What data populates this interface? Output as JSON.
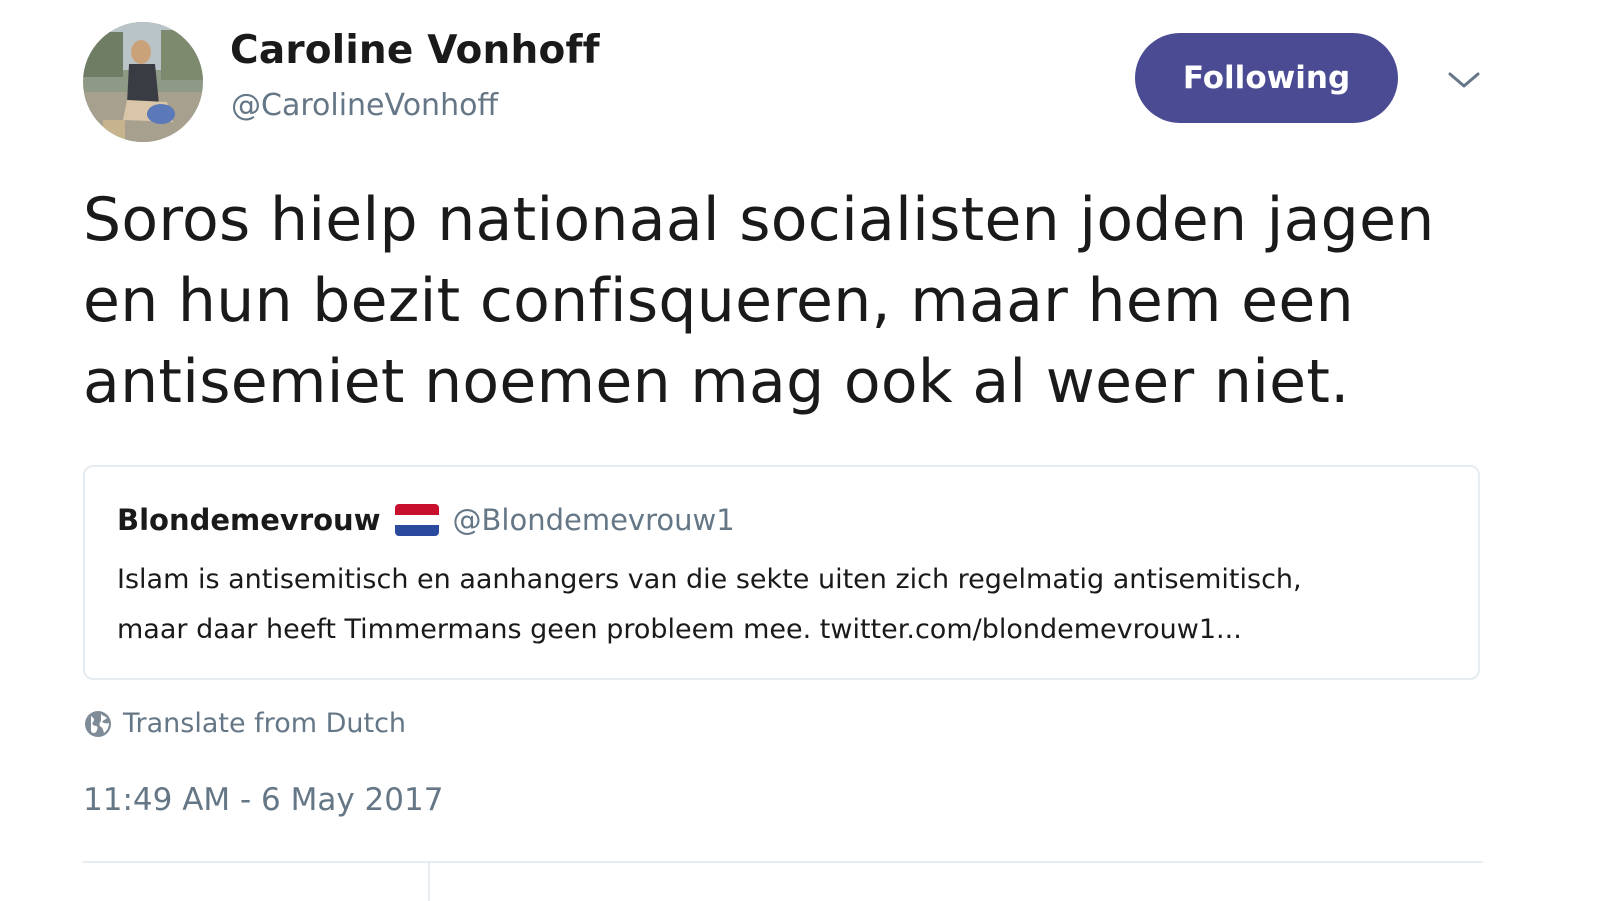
{
  "author": {
    "display_name": "Caroline Vonhoff",
    "screen_name": "@CarolineVonhoff",
    "avatar_icon": "user-photo-avatar"
  },
  "follow_button": {
    "label": "Following",
    "color": "#4b4b94"
  },
  "menu": {
    "icon": "chevron-down-icon"
  },
  "tweet": {
    "text_lines": [
      "Soros hielp nationaal socialisten joden jagen",
      "en hun bezit confisqueren, maar hem een",
      "antisemiet noemen mag ook al weer niet."
    ]
  },
  "quoted_tweet": {
    "display_name": "Blondemevrouw",
    "flag_icon": "netherlands-flag-icon",
    "screen_name": "@Blondemevrouw1",
    "text_lines": [
      "Islam is antisemitisch en aanhangers van die sekte uiten zich regelmatig antisemitisch,",
      "maar daar heeft Timmermans geen probleem mee. twitter.com/blondemevrouw1..."
    ]
  },
  "translate": {
    "icon": "globe-icon",
    "label": "Translate from Dutch"
  },
  "timestamp": "11:49 AM - 6 May 2017",
  "colors": {
    "secondary_text": "#657786",
    "border": "#e6ecf0"
  }
}
